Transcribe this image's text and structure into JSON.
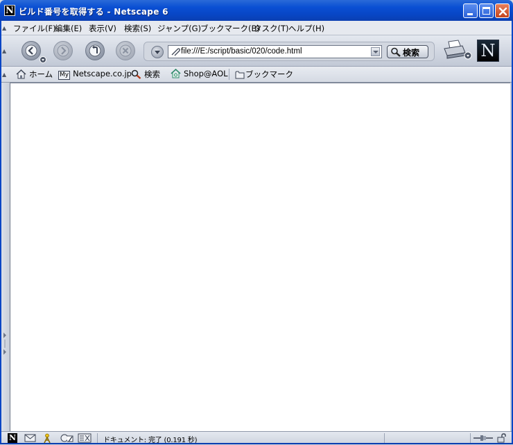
{
  "window": {
    "title": "ビルド番号を取得する - Netscape 6",
    "app_icon_letter": "N"
  },
  "menu": {
    "items": [
      "ファイル(F)",
      "編集(E)",
      "表示(V)",
      "検索(S)",
      "ジャンプ(G)",
      "ブックマーク(B)",
      "タスク(T)",
      "ヘルプ(H)"
    ]
  },
  "navigation": {
    "url": "file:///E:/script/basic/020/code.html",
    "search_label": "検索",
    "logo_letter": "N",
    "icons": [
      "back-icon",
      "forward-icon",
      "reload-icon",
      "stop-icon",
      "print-icon"
    ]
  },
  "personal_toolbar": {
    "items": [
      {
        "label": "ホーム",
        "icon": "home-icon"
      },
      {
        "label": "Netscape.co.jp",
        "icon": "my-icon",
        "icon_text": "My"
      },
      {
        "label": "検索",
        "icon": "search-icon"
      },
      {
        "label": "Shop@AOL",
        "icon": "shop-icon"
      },
      {
        "label": "ブックマーク",
        "icon": "folder-icon"
      }
    ]
  },
  "status": {
    "text": "ドキュメント: 完了 (0.191 秒)",
    "icons": [
      "netscape-icon",
      "mail-icon",
      "instant-messenger-icon",
      "composer-icon",
      "address-book-icon",
      "online-status-icon",
      "security-lock-icon"
    ]
  },
  "colors": {
    "titlebar": "#0a4fd3",
    "chrome": "#d7dce6",
    "content_bg": "#ffffff"
  }
}
